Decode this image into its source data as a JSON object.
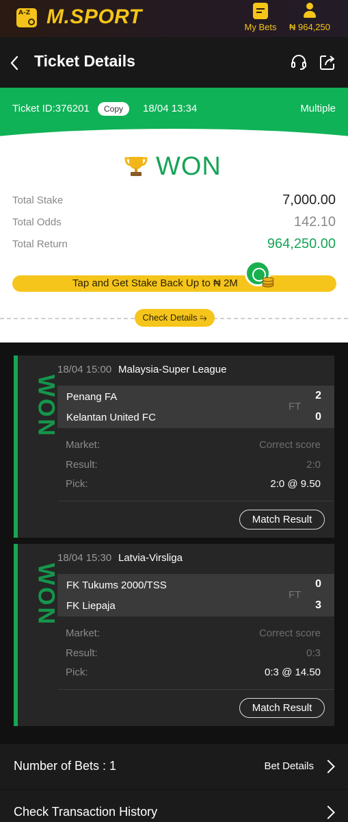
{
  "topbar": {
    "az_label": "A-Z",
    "brand": "M.SPORT",
    "my_bets_label": "My Bets",
    "balance": "₦ 964,250"
  },
  "header": {
    "title": "Ticket Details"
  },
  "ticket": {
    "id_label": "Ticket ID:376201",
    "copy_label": "Copy",
    "date": "18/04 13:34",
    "kind": "Multiple",
    "status": "WON",
    "total_stake_label": "Total Stake",
    "total_stake": "7,000.00",
    "total_odds_label": "Total Odds",
    "total_odds": "142.10",
    "total_return_label": "Total Return",
    "total_return": "964,250.00",
    "promo": "Tap and Get Stake Back Up to ₦ 2M",
    "check_details": "Check Details"
  },
  "bets": [
    {
      "status": "WON",
      "time": "18/04 15:00",
      "league": "Malaysia-Super League",
      "home": "Penang FA",
      "away": "Kelantan United FC",
      "status_code": "FT",
      "home_score": "2",
      "away_score": "0",
      "market_label": "Market:",
      "market": "Correct score",
      "result_label": "Result:",
      "result": "2:0",
      "pick_label": "Pick:",
      "pick": "2:0 @ 9.50",
      "match_result": "Match Result"
    },
    {
      "status": "WON",
      "time": "18/04 15:30",
      "league": "Latvia-Virsliga",
      "home": "FK Tukums 2000/TSS",
      "away": "FK Liepaja",
      "status_code": "FT",
      "home_score": "0",
      "away_score": "3",
      "market_label": "Market:",
      "market": "Correct score",
      "result_label": "Result:",
      "result": "0:3",
      "pick_label": "Pick:",
      "pick": "0:3 @ 14.50",
      "match_result": "Match Result"
    }
  ],
  "footer": {
    "number_of_bets_label": "Number of Bets :  1",
    "bet_details": "Bet Details",
    "transaction_history": "Check Transaction History"
  },
  "colors": {
    "accent_green": "#0fb257",
    "brand_yellow": "#f5c518"
  }
}
